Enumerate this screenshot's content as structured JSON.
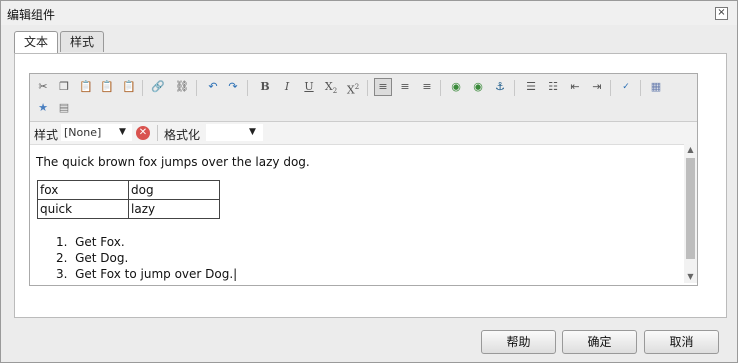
{
  "dialog": {
    "title": "编辑组件",
    "close_icon": "×"
  },
  "tabs": [
    {
      "label": "文本"
    },
    {
      "label": "样式"
    }
  ],
  "toolbar": {
    "icons": [
      "cut",
      "copy",
      "paste",
      "paste-text",
      "paste-word",
      "link",
      "unlink",
      "undo",
      "redo",
      "bold",
      "italic",
      "underline",
      "subscript",
      "superscript",
      "align-left",
      "align-center",
      "align-right",
      "image",
      "image-edit",
      "anchor",
      "bulleted-list",
      "numbered-list",
      "outdent",
      "indent",
      "spellcheck",
      "table",
      "special-char",
      "find-replace"
    ]
  },
  "stylebar": {
    "style_label": "样式",
    "style_value": "[None]",
    "format_label": "格式化",
    "format_value": ""
  },
  "content": {
    "paragraph": "The quick brown fox jumps over the lazy dog.",
    "table": [
      [
        "fox",
        "dog"
      ],
      [
        "quick",
        "lazy"
      ]
    ],
    "list": [
      "Get Fox.",
      "Get Dog.",
      "Get Fox to jump over Dog."
    ]
  },
  "buttons": {
    "help": "帮助",
    "ok": "确定",
    "cancel": "取消"
  }
}
